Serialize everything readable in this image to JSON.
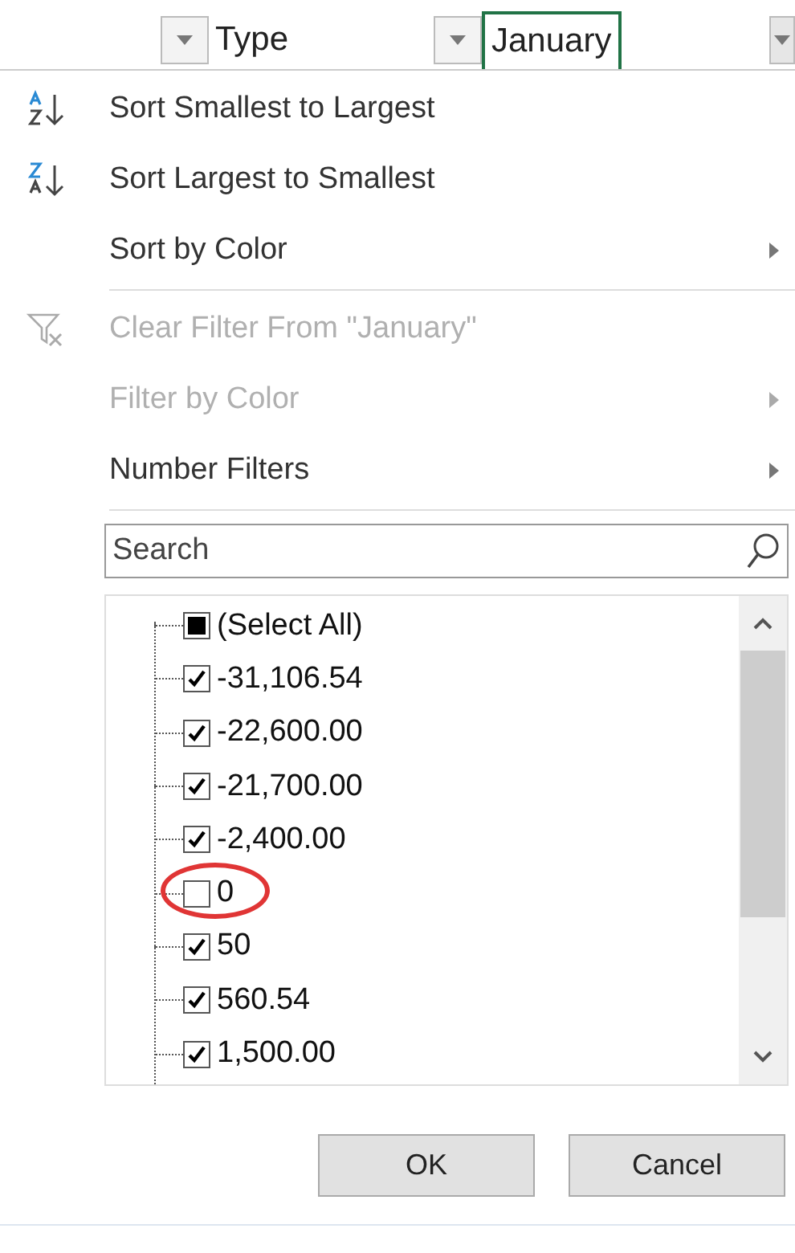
{
  "header": [
    {
      "label": "Type",
      "selected": false
    },
    {
      "label": "January",
      "selected": true
    }
  ],
  "menu": [
    {
      "kind": "sort_ascending",
      "label": "Sort Smallest to Largest",
      "disabled": false,
      "submenu": false
    },
    {
      "kind": "sort_descending",
      "label": "Sort Largest to Smallest",
      "disabled": false,
      "submenu": false
    },
    {
      "kind": "plain",
      "label": "Sort by Color",
      "disabled": false,
      "submenu": true
    },
    {
      "kind": "separator"
    },
    {
      "kind": "clear_filter",
      "label": "Clear Filter From \"January\"",
      "disabled": true,
      "submenu": false
    },
    {
      "kind": "plain",
      "label": "Filter by Color",
      "disabled": true,
      "submenu": true
    },
    {
      "kind": "plain",
      "label": "Number Filters",
      "disabled": false,
      "submenu": true
    },
    {
      "kind": "separator"
    }
  ],
  "search": {
    "placeholder": "Search"
  },
  "select_all": {
    "label": "(Select All)",
    "indeterminate": true
  },
  "values": [
    {
      "label": "-31,106.54",
      "checked": true,
      "circled": false
    },
    {
      "label": "-22,600.00",
      "checked": true,
      "circled": false
    },
    {
      "label": "-21,700.00",
      "checked": true,
      "circled": false
    },
    {
      "label": "-2,400.00",
      "checked": true,
      "circled": false
    },
    {
      "label": "0",
      "checked": false,
      "circled": true
    },
    {
      "label": "50",
      "checked": true,
      "circled": false
    },
    {
      "label": "560.54",
      "checked": true,
      "circled": false
    },
    {
      "label": "1,500.00",
      "checked": true,
      "circled": false
    }
  ],
  "buttons": [
    "OK",
    "Cancel"
  ]
}
